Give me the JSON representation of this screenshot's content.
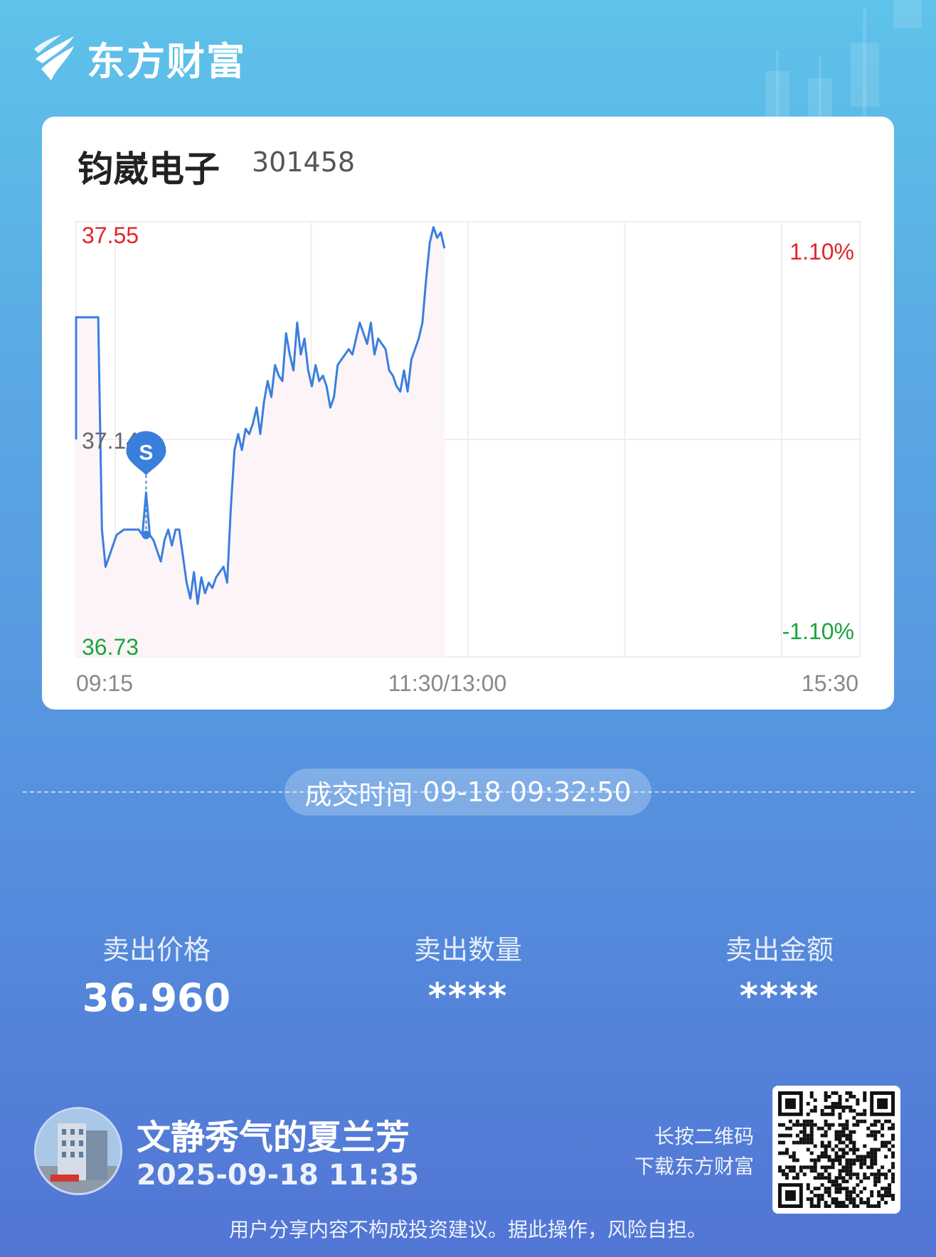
{
  "brand": {
    "name": "东方财富",
    "logo_icon": "eastmoney-logo-icon"
  },
  "stock": {
    "name": "钧崴电子",
    "code": "301458"
  },
  "chart_data": {
    "type": "line",
    "title": "",
    "y_high_label": "37.55",
    "y_mid_label": "37.14",
    "y_low_label": "36.73",
    "pct_high_label": "1.10%",
    "pct_low_label": "-1.10%",
    "x_labels": [
      "09:15",
      "11:30/13:00",
      "15:30"
    ],
    "ylim": [
      36.73,
      37.55
    ],
    "grid": true,
    "trade_marker": {
      "label": "S",
      "time": "09:32",
      "price": 36.96
    },
    "series": [
      {
        "values": [
          [
            0,
            37.14
          ],
          [
            0,
            37.37
          ],
          [
            4,
            37.37
          ],
          [
            5,
            37.37
          ],
          [
            6,
            37.37
          ],
          [
            7,
            36.97
          ],
          [
            8,
            36.9
          ],
          [
            9,
            36.92
          ],
          [
            11,
            36.96
          ],
          [
            13,
            36.97
          ],
          [
            15,
            36.97
          ],
          [
            17,
            36.97
          ],
          [
            18,
            36.96
          ],
          [
            19,
            37.04
          ],
          [
            20,
            36.96
          ],
          [
            21,
            36.95
          ],
          [
            22,
            36.93
          ],
          [
            23,
            36.91
          ],
          [
            24,
            36.95
          ],
          [
            25,
            36.97
          ],
          [
            26,
            36.94
          ],
          [
            27,
            36.97
          ],
          [
            28,
            36.97
          ],
          [
            29,
            36.92
          ],
          [
            30,
            36.87
          ],
          [
            31,
            36.84
          ],
          [
            32,
            36.89
          ],
          [
            33,
            36.83
          ],
          [
            34,
            36.88
          ],
          [
            35,
            36.85
          ],
          [
            36,
            36.87
          ],
          [
            37,
            36.86
          ],
          [
            38,
            36.88
          ],
          [
            39,
            36.89
          ],
          [
            40,
            36.9
          ],
          [
            41,
            36.87
          ],
          [
            42,
            37.01
          ],
          [
            43,
            37.12
          ],
          [
            44,
            37.15
          ],
          [
            45,
            37.12
          ],
          [
            46,
            37.16
          ],
          [
            47,
            37.15
          ],
          [
            48,
            37.17
          ],
          [
            49,
            37.2
          ],
          [
            50,
            37.15
          ],
          [
            51,
            37.21
          ],
          [
            52,
            37.25
          ],
          [
            53,
            37.22
          ],
          [
            54,
            37.28
          ],
          [
            55,
            37.26
          ],
          [
            56,
            37.25
          ],
          [
            57,
            37.34
          ],
          [
            58,
            37.3
          ],
          [
            59,
            37.27
          ],
          [
            60,
            37.36
          ],
          [
            61,
            37.3
          ],
          [
            62,
            37.33
          ],
          [
            63,
            37.27
          ],
          [
            64,
            37.24
          ],
          [
            65,
            37.28
          ],
          [
            66,
            37.25
          ],
          [
            67,
            37.26
          ],
          [
            68,
            37.24
          ],
          [
            69,
            37.2
          ],
          [
            70,
            37.22
          ],
          [
            71,
            37.28
          ],
          [
            72,
            37.29
          ],
          [
            73,
            37.3
          ],
          [
            74,
            37.31
          ],
          [
            75,
            37.3
          ],
          [
            76,
            37.33
          ],
          [
            77,
            37.36
          ],
          [
            78,
            37.34
          ],
          [
            79,
            37.32
          ],
          [
            80,
            37.36
          ],
          [
            81,
            37.3
          ],
          [
            82,
            37.33
          ],
          [
            83,
            37.32
          ],
          [
            84,
            37.31
          ],
          [
            85,
            37.27
          ],
          [
            86,
            37.26
          ],
          [
            87,
            37.24
          ],
          [
            88,
            37.23
          ],
          [
            89,
            37.27
          ],
          [
            90,
            37.23
          ],
          [
            91,
            37.29
          ],
          [
            92,
            37.31
          ],
          [
            93,
            37.33
          ],
          [
            94,
            37.36
          ],
          [
            95,
            37.44
          ],
          [
            96,
            37.51
          ],
          [
            97,
            37.54
          ],
          [
            98,
            37.52
          ],
          [
            99,
            37.53
          ],
          [
            100,
            37.5
          ]
        ]
      }
    ]
  },
  "trade": {
    "label": "成交时间",
    "time": "09-18 09:32:50"
  },
  "stats": {
    "price_label": "卖出价格",
    "price_value": "36.960",
    "qty_label": "卖出数量",
    "qty_value": "****",
    "amount_label": "卖出金额",
    "amount_value": "****"
  },
  "user": {
    "name": "文静秀气的夏兰芳",
    "time": "2025-09-18 11:35"
  },
  "qr_hint": {
    "line1": "长按二维码",
    "line2": "下载东方财富"
  },
  "disclaimer": "用户分享内容不构成投资建议。据此操作，风险自担。"
}
